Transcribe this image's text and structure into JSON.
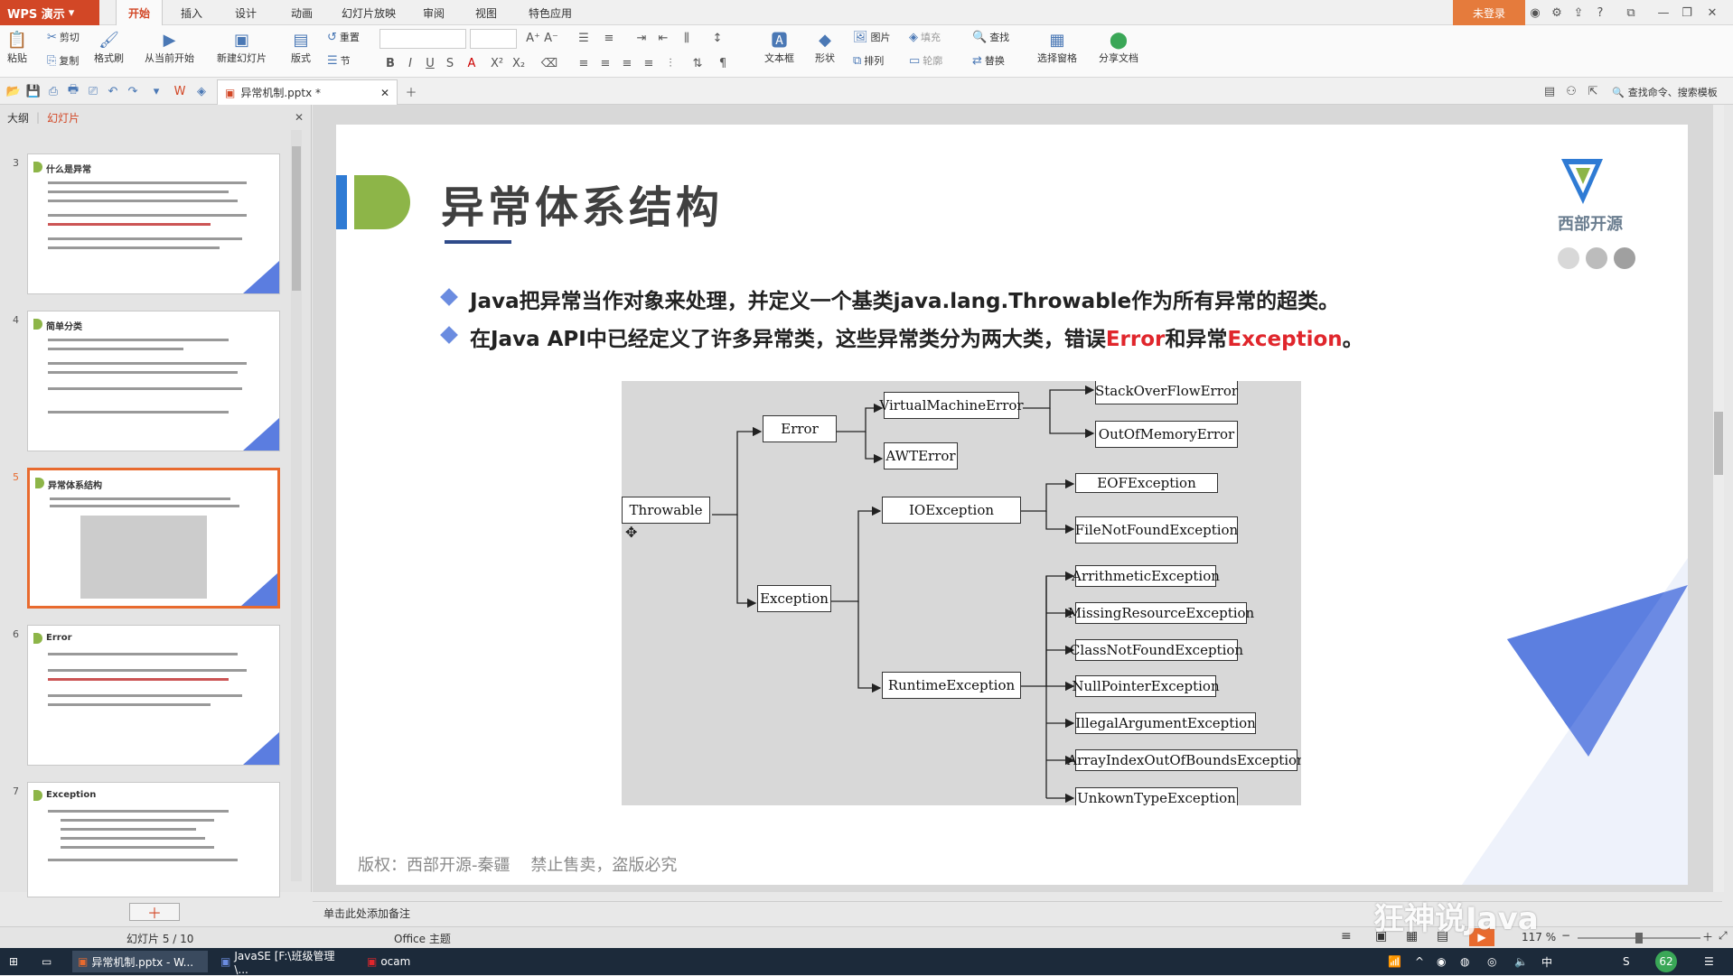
{
  "app": {
    "name": "WPS 演示",
    "login": "未登录"
  },
  "menu_tabs": [
    "开始",
    "插入",
    "设计",
    "动画",
    "幻灯片放映",
    "审阅",
    "视图",
    "特色应用"
  ],
  "ribbon": {
    "paste": "粘贴",
    "cut": "剪切",
    "copy": "复制",
    "format_painter": "格式刷",
    "from_current": "从当前开始",
    "new_slide": "新建幻灯片",
    "layout": "版式",
    "reset": "重置",
    "section": "节",
    "text_box": "文本框",
    "shape": "形状",
    "picture": "图片",
    "fill": "填充",
    "arrange": "排列",
    "outline": "轮廓",
    "find": "查找",
    "replace": "替换",
    "selection_pane": "选择窗格",
    "share": "分享文档"
  },
  "qat": {
    "doc_name": "异常机制.pptx *",
    "right_search": "查找命令、搜索模板"
  },
  "sidepanel": {
    "tab_outline": "大纲",
    "tab_slides": "幻灯片"
  },
  "thumbnails": [
    {
      "num": "3",
      "title": "什么是异常"
    },
    {
      "num": "4",
      "title": "简单分类"
    },
    {
      "num": "5",
      "title": "异常体系结构"
    },
    {
      "num": "6",
      "title": "Error"
    },
    {
      "num": "7",
      "title": "Exception"
    }
  ],
  "slide": {
    "title": "异常体系结构",
    "logo_text": "西部开源",
    "bullet1": "Java把异常当作对象来处理，并定义一个基类java.lang.Throwable作为所有异常的超类。",
    "bullet2_pre": "在Java API中已经定义了许多异常类，这些异常类分为两大类，错误",
    "bullet2_error": "Error",
    "bullet2_mid": "和异常",
    "bullet2_exc": "Exception",
    "bullet2_end": "。",
    "footer": "版权：西部开源-秦疆    禁止售卖，盗版必究",
    "diagram": {
      "throwable": "Throwable",
      "error": "Error",
      "exception": "Exception",
      "vme": "VirtualMachineError",
      "awt": "AWTError",
      "soe": "StackOverFlowError",
      "oom": "OutOfMemoryError",
      "ioe": "IOException",
      "eof": "EOFException",
      "fnf": "FileNotFoundException",
      "rte": "RuntimeException",
      "arith": "ArrithmeticException",
      "mre": "MissingResourceException",
      "cnf": "ClassNotFoundException",
      "npe": "NullPointerException",
      "iae": "IllegalArgumentException",
      "aioobe": "ArrayIndexOutOfBoundsException",
      "ute": "UnkownTypeException"
    }
  },
  "notes": "单击此处添加备注",
  "status": {
    "slide_info": "幻灯片 5 / 10",
    "theme": "Office 主题",
    "zoom": "117 %"
  },
  "taskbar": {
    "item1": "异常机制.pptx - W...",
    "item2": "JavaSE [F:\\班级管理\\...",
    "item3": "ocam",
    "clock": "62"
  },
  "watermark": "狂神说Java"
}
